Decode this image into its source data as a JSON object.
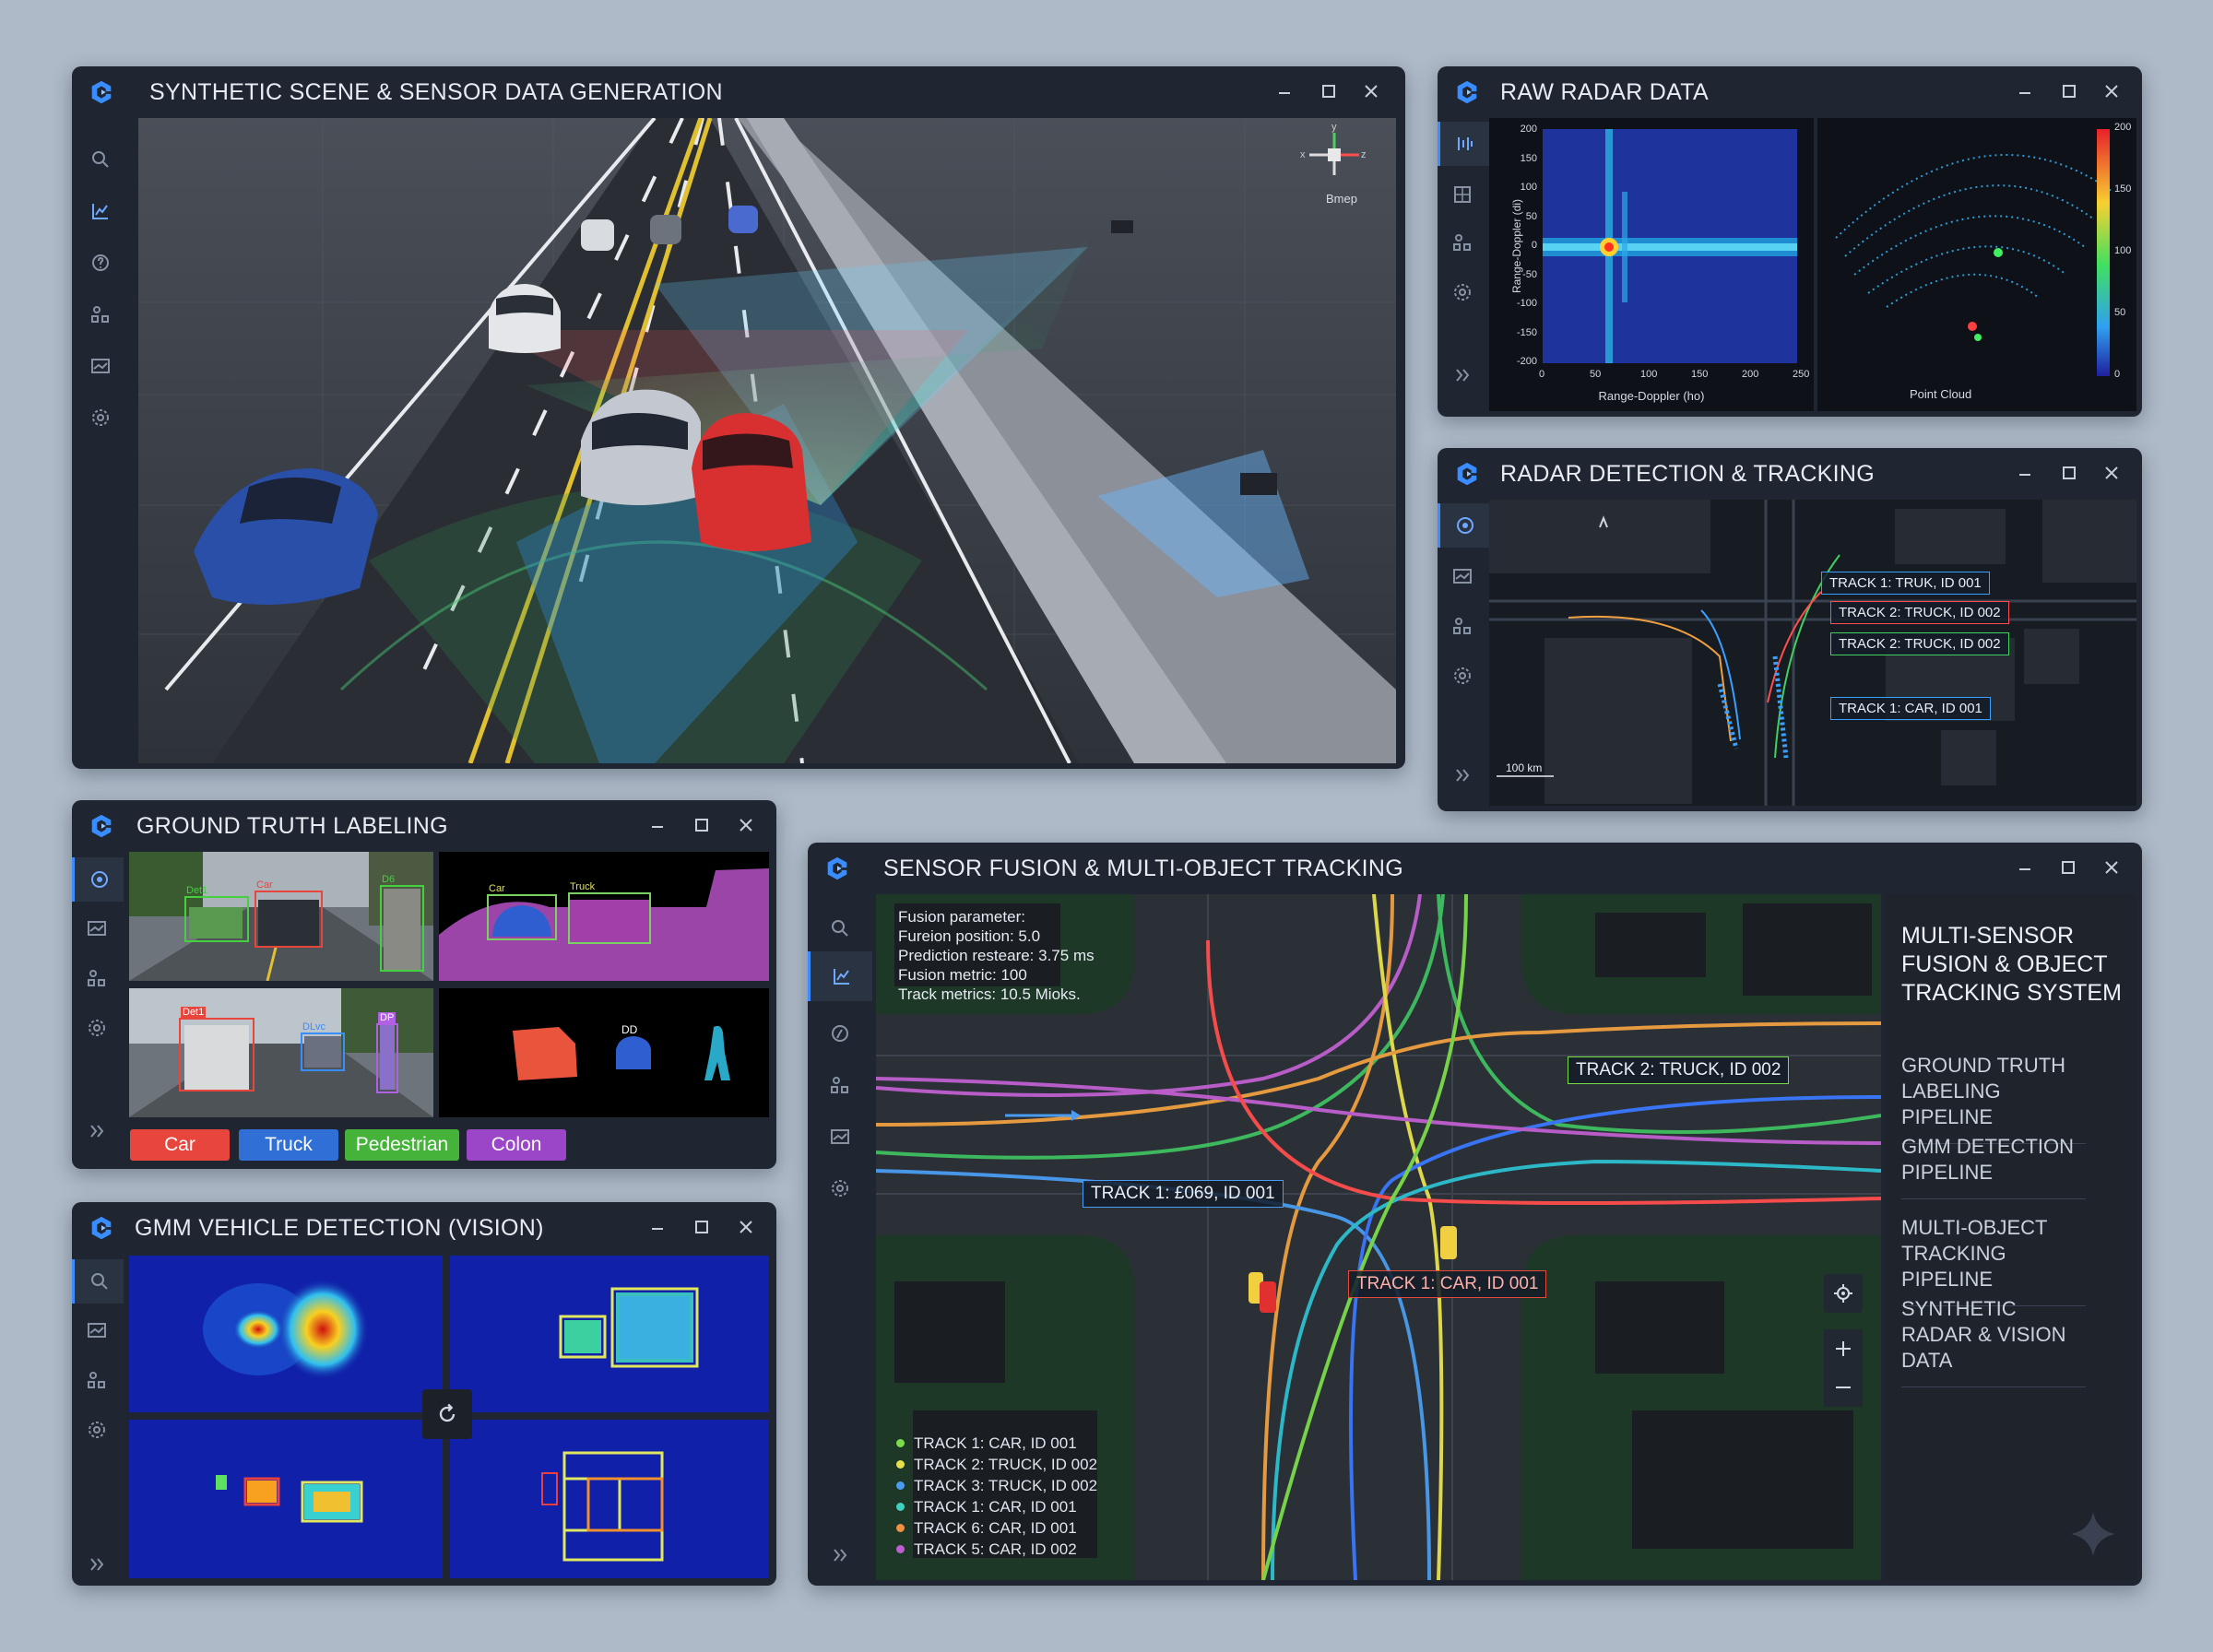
{
  "windows": {
    "synthetic": {
      "title": "SYNTHETIC SCENE & SENSOR DATA GENERATION",
      "gizmo": {
        "y": "y",
        "x": "x",
        "z": "z",
        "view_label": "Bmep"
      }
    },
    "raw_radar": {
      "title": "RAW RADAR DATA",
      "rd": {
        "ylabel": "Range-Doppler (di)",
        "xlabel": "Range-Doppler (ho)",
        "yticks": [
          "200",
          "150",
          "100",
          "50",
          "0",
          "-50",
          "-100",
          "-150",
          "-200"
        ],
        "xticks": [
          "0",
          "50",
          "100",
          "150",
          "200",
          "250"
        ]
      },
      "pc": {
        "label": "Point Cloud",
        "cbar_ticks": [
          "200",
          "150",
          "100",
          "50",
          "0"
        ]
      }
    },
    "radar_track": {
      "title": "RADAR DETECTION & TRACKING",
      "tracks": [
        {
          "label": "TRACK 1: TRUK, ID 001",
          "color": "#3aa0ff"
        },
        {
          "label": "TRACK 2: TRUCK, ID 002",
          "color": "#ff4d4d"
        },
        {
          "label": "TRACK 2: TRUCK, ID 002",
          "color": "#40d060"
        },
        {
          "label": "TRACK 1: CAR, ID 001",
          "color": "#3aa0ff"
        }
      ],
      "scale": "100 km"
    },
    "gt": {
      "title": "GROUND TRUTH LABELING",
      "boxes": {
        "det1": "Det1",
        "car": "Car",
        "d6": "D6",
        "det1b": "Det1",
        "dlvc": "DLvc",
        "dp": "DP"
      },
      "seg": {
        "car": "Car",
        "truck": "Truck",
        "dd": "DD"
      },
      "chips": [
        {
          "label": "Car",
          "color": "#e8453c"
        },
        {
          "label": "Truck",
          "color": "#2f6fd6"
        },
        {
          "label": "Pedestrian",
          "color": "#45b33a"
        },
        {
          "label": "Colon",
          "color": "#9b45c9"
        }
      ]
    },
    "gmm": {
      "title": "GMM VEHICLE DETECTION (VISION)"
    },
    "fusion": {
      "title": "SENSOR FUSION & MULTI-OBJECT TRACKING",
      "params": [
        "Fusion parameter:",
        "Fureion position: 5.0",
        "Prediction resteare: 3.75 ms",
        "Fusion metric:  100",
        "Track metrics: 10.5 Mioks."
      ],
      "tags": {
        "t2": "TRACK 2: TRUCK, ID 002",
        "t1a": "TRACK 1: £069, ID 001",
        "t1b": "TRACK 1: CAR, ID 001"
      },
      "legend": [
        {
          "label": "TRACK 1: CAR, ID 001",
          "color": "#7bdc4a"
        },
        {
          "label": "TRACK 2: TRUCK, ID 002",
          "color": "#e8e04a"
        },
        {
          "label": "TRACK 3: TRUCK, ID 002",
          "color": "#4a9cf0"
        },
        {
          "label": "TRACK 1: CAR, ID 001",
          "color": "#3ed0c0"
        },
        {
          "label": "TRACK 6: CAR, ID 001",
          "color": "#f09040"
        },
        {
          "label": "TRACK 5: CAR, ID 002",
          "color": "#c060d0"
        }
      ],
      "side_title": "MULTI-SENSOR FUSION & OBJECT TRACKING SYSTEM",
      "menu": [
        "GROUND TRUTH LABELING PIPELINE",
        "GMM DETECTION PIPELINE",
        "MULTI-OBJECT TRACKING PIPELINE",
        "SYNTHETIC RADAR & VISION DATA"
      ]
    }
  }
}
